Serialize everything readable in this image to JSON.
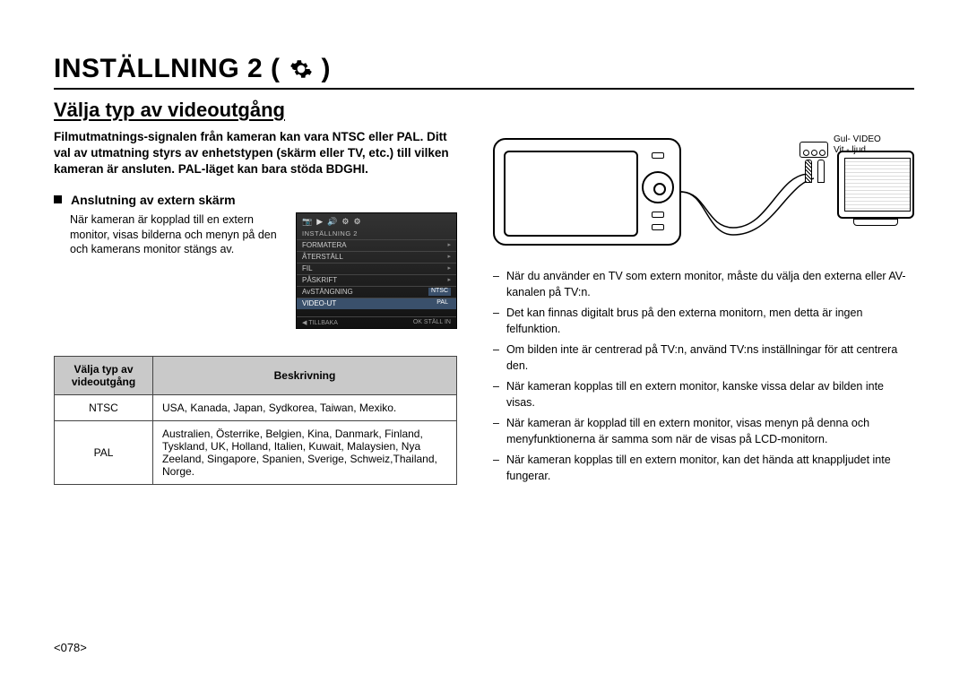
{
  "chapter": {
    "title_prefix": "INSTÄLLNING 2 (",
    "title_suffix": ")",
    "gear_icon_name": "gear-icon"
  },
  "section": {
    "title": "Välja typ av videoutgång"
  },
  "intro": "Filmutmatnings-signalen från kameran kan vara NTSC eller PAL. Ditt val av utmatning styrs av enhetstypen (skärm eller TV, etc.) till vilken kameran är ansluten. PAL-läget kan bara stöda BDGHI.",
  "subhead": "Anslutning av extern skärm",
  "body": "När kameran är kopplad till en extern monitor, visas bilderna och menyn på den och kamerans monitor stängs av.",
  "camera_ui": {
    "title": "INSTÄLLNING 2",
    "icons": [
      "📷",
      "▶",
      "🔊",
      "⚙",
      "⚙"
    ],
    "items": [
      {
        "label": "FORMATERA",
        "value": ""
      },
      {
        "label": "ÅTERSTÄLL",
        "value": ""
      },
      {
        "label": "FIL",
        "value": ""
      },
      {
        "label": "PÅSKRIFT",
        "value": ""
      },
      {
        "label": "AvSTÄNGNING",
        "value": "NTSC"
      },
      {
        "label": "VIDEO-UT",
        "value": "PAL"
      }
    ],
    "footer_left": "◀  TILLBAKA",
    "footer_right": "OK  STÄLL IN"
  },
  "table": {
    "head_col1_line1": "Välja typ av",
    "head_col1_line2": "videoutgång",
    "head_col2": "Beskrivning",
    "rows": [
      {
        "opt": "NTSC",
        "desc": "USA, Kanada, Japan, Sydkorea, Taiwan, Mexiko."
      },
      {
        "opt": "PAL",
        "desc": "Australien, Österrike, Belgien, Kina, Danmark, Finland, Tyskland, UK, Holland, Italien, Kuwait, Malaysien, Nya Zeeland, Singapore, Spanien, Sverige, Schweiz,Thailand, Norge."
      }
    ]
  },
  "diagram": {
    "label_line1": "Gul- VIDEO",
    "label_line2": "Vit - ljud"
  },
  "notes": [
    "När du använder en TV som extern monitor, måste du välja den externa eller AV-kanalen på TV:n.",
    "Det kan finnas digitalt brus på den externa monitorn, men detta är ingen felfunktion.",
    "Om bilden inte är centrerad på TV:n, använd TV:ns inställningar för att centrera den.",
    "När kameran kopplas till en extern monitor, kanske vissa delar av bilden inte visas.",
    "När kameran är kopplad till en extern monitor, visas menyn på denna och menyfunktionerna är samma som när de visas på LCD-monitorn.",
    "När kameran kopplas till en extern monitor, kan det hända att knappljudet inte fungerar."
  ],
  "page_number": "<078>"
}
